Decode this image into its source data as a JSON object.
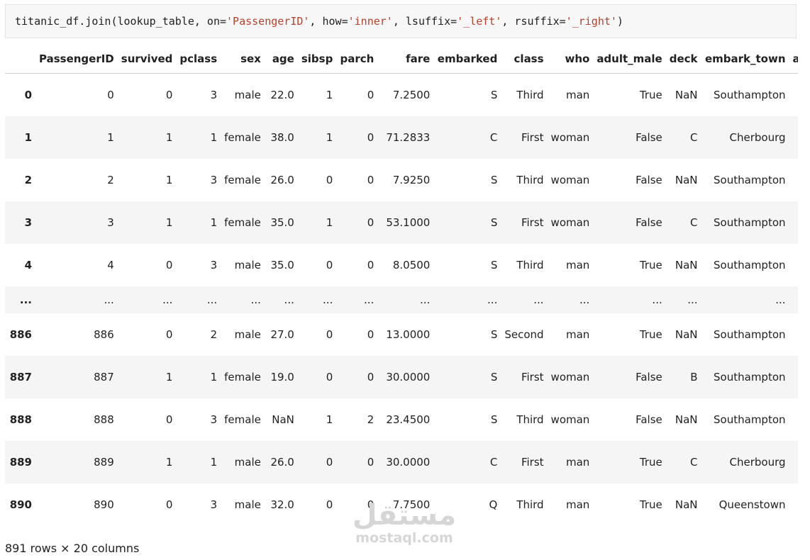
{
  "code": {
    "parts": [
      {
        "text": "titanic_df.join(lookup_table, on=",
        "type": "plain"
      },
      {
        "text": "'PassengerID'",
        "type": "str"
      },
      {
        "text": ", how=",
        "type": "plain"
      },
      {
        "text": "'inner'",
        "type": "str"
      },
      {
        "text": ", lsuffix=",
        "type": "plain"
      },
      {
        "text": "'_left'",
        "type": "str"
      },
      {
        "text": ", rsuffix=",
        "type": "plain"
      },
      {
        "text": "'_right'",
        "type": "str"
      },
      {
        "text": ")",
        "type": "plain"
      }
    ]
  },
  "table": {
    "columns": [
      "",
      "PassengerID",
      "survived",
      "pclass",
      "sex",
      "age",
      "sibsp",
      "parch",
      "fare",
      "embarked",
      "class",
      "who",
      "adult_male",
      "deck",
      "embark_town",
      "al"
    ],
    "rows": [
      [
        "0",
        "0",
        "0",
        "3",
        "male",
        "22.0",
        "1",
        "0",
        "7.2500",
        "S",
        "Third",
        "man",
        "True",
        "NaN",
        "Southampton",
        ""
      ],
      [
        "1",
        "1",
        "1",
        "1",
        "female",
        "38.0",
        "1",
        "0",
        "71.2833",
        "C",
        "First",
        "woman",
        "False",
        "C",
        "Cherbourg",
        ""
      ],
      [
        "2",
        "2",
        "1",
        "3",
        "female",
        "26.0",
        "0",
        "0",
        "7.9250",
        "S",
        "Third",
        "woman",
        "False",
        "NaN",
        "Southampton",
        ""
      ],
      [
        "3",
        "3",
        "1",
        "1",
        "female",
        "35.0",
        "1",
        "0",
        "53.1000",
        "S",
        "First",
        "woman",
        "False",
        "C",
        "Southampton",
        ""
      ],
      [
        "4",
        "4",
        "0",
        "3",
        "male",
        "35.0",
        "0",
        "0",
        "8.0500",
        "S",
        "Third",
        "man",
        "True",
        "NaN",
        "Southampton",
        ""
      ],
      [
        "...",
        "...",
        "...",
        "...",
        "...",
        "...",
        "...",
        "...",
        "...",
        "...",
        "...",
        "...",
        "...",
        "...",
        "...",
        ""
      ],
      [
        "886",
        "886",
        "0",
        "2",
        "male",
        "27.0",
        "0",
        "0",
        "13.0000",
        "S",
        "Second",
        "man",
        "True",
        "NaN",
        "Southampton",
        ""
      ],
      [
        "887",
        "887",
        "1",
        "1",
        "female",
        "19.0",
        "0",
        "0",
        "30.0000",
        "S",
        "First",
        "woman",
        "False",
        "B",
        "Southampton",
        ""
      ],
      [
        "888",
        "888",
        "0",
        "3",
        "female",
        "NaN",
        "1",
        "2",
        "23.4500",
        "S",
        "Third",
        "woman",
        "False",
        "NaN",
        "Southampton",
        ""
      ],
      [
        "889",
        "889",
        "1",
        "1",
        "male",
        "26.0",
        "0",
        "0",
        "30.0000",
        "C",
        "First",
        "man",
        "True",
        "C",
        "Cherbourg",
        ""
      ],
      [
        "890",
        "890",
        "0",
        "3",
        "male",
        "32.0",
        "0",
        "0",
        "7.7500",
        "Q",
        "Third",
        "man",
        "True",
        "NaN",
        "Queenstown",
        ""
      ]
    ]
  },
  "summary": "891 rows × 20 columns",
  "watermark": {
    "logo": "مستقل",
    "text": "mostaql.com"
  }
}
